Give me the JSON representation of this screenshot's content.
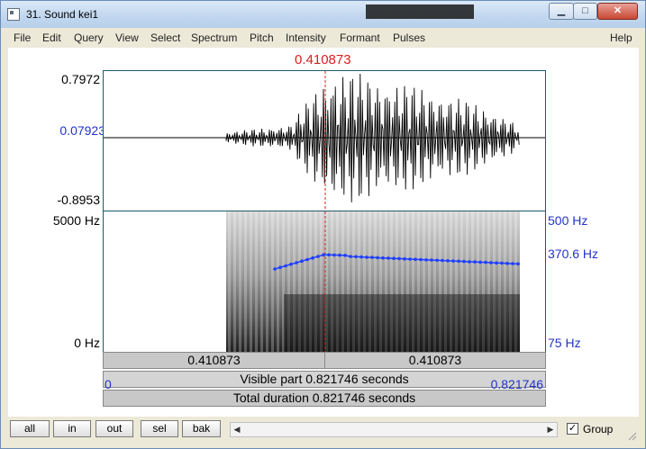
{
  "window": {
    "title": "31. Sound kei1",
    "minimize": "▁",
    "maximize": "□",
    "close": "✕"
  },
  "menu": [
    "File",
    "Edit",
    "Query",
    "View",
    "Select",
    "Spectrum",
    "Pitch",
    "Intensity",
    "Formant",
    "Pulses",
    "Help"
  ],
  "cursor_time": "0.410873",
  "waveform": {
    "y_max": "0.7972",
    "y_cursor": "0.07923",
    "y_min": "-0.8953"
  },
  "spectrogram": {
    "freq_max": "5000 Hz",
    "freq_min": "0 Hz",
    "pitch_max": "500 Hz",
    "pitch_cursor": "370.6 Hz",
    "pitch_min": "75 Hz"
  },
  "time_bars": {
    "left_segment": "0.410873",
    "right_segment": "0.410873",
    "visible_start": "0",
    "visible_label": "Visible part 0.821746 seconds",
    "visible_end": "0.821746",
    "total_label": "Total duration 0.821746 seconds"
  },
  "bottom": {
    "all": "all",
    "in": "in",
    "out": "out",
    "sel": "sel",
    "bak": "bak",
    "group": "Group",
    "group_checked": true,
    "scroll_left": "◀",
    "scroll_right": "▶",
    "check_mark": "✓"
  },
  "colors": {
    "cursor": "#d81f1f",
    "pitch": "#1f3fff",
    "axis_blue": "#2233cc"
  }
}
